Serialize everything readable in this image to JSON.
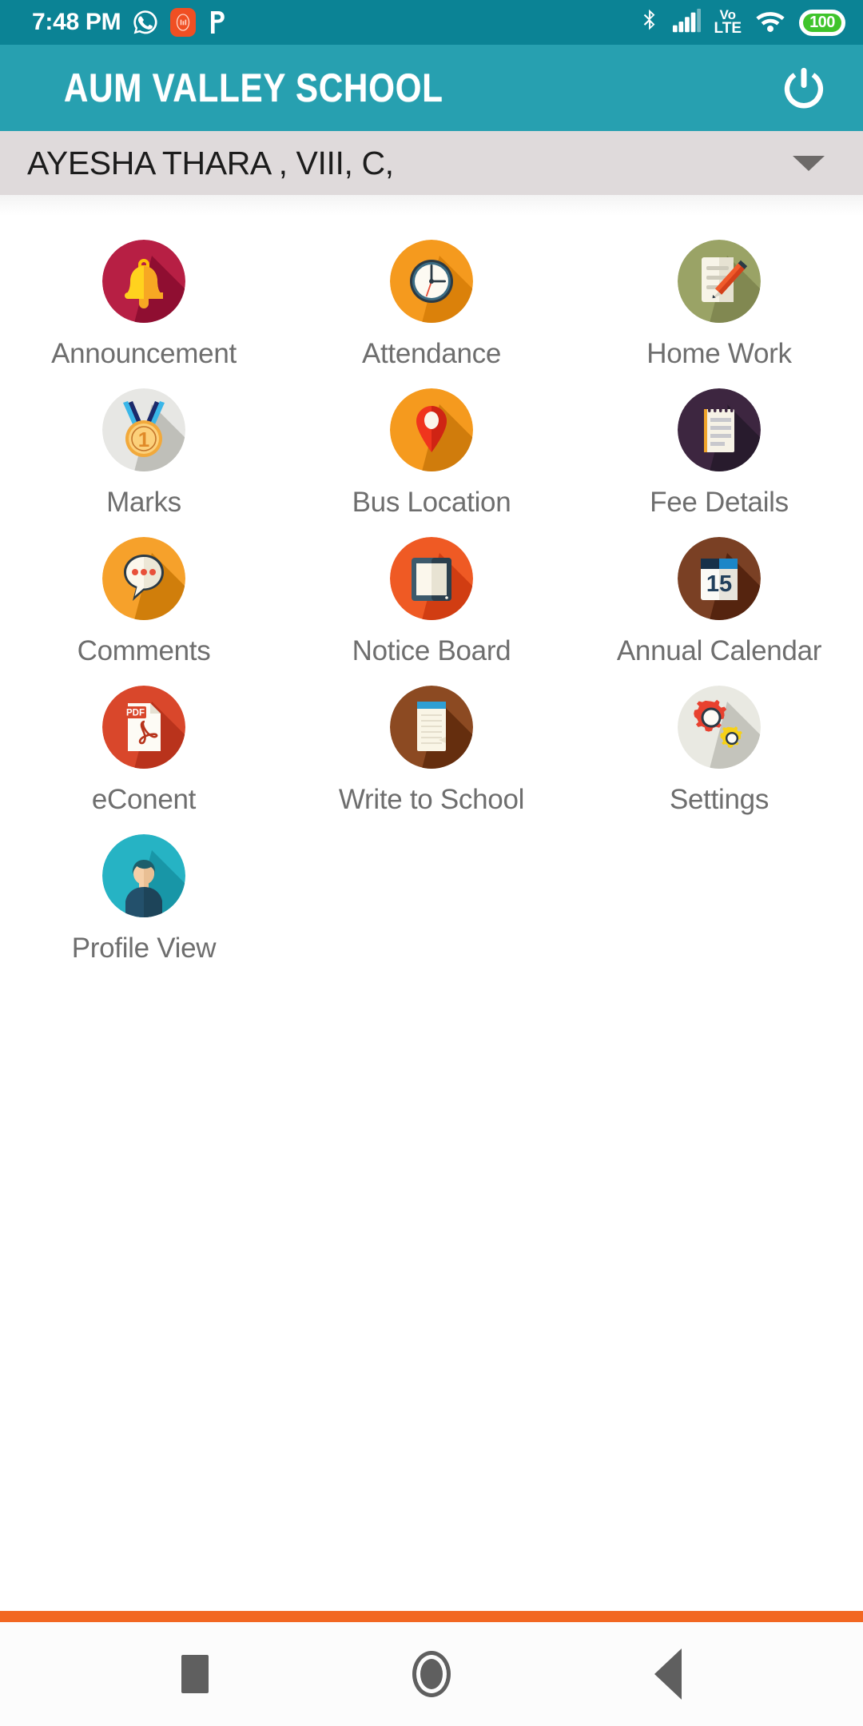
{
  "status_bar": {
    "time": "7:48 PM",
    "battery_level": "100",
    "network_type": "VoLTE",
    "volte_top": "Vo",
    "volte_bottom": "LTE",
    "icons": [
      "whatsapp-icon",
      "mi-video-call-icon",
      "phonepe-icon",
      "bluetooth-icon",
      "cellular-signal-icon",
      "volte-icon",
      "wifi-icon",
      "battery-icon"
    ],
    "background_color": "#0b8395"
  },
  "app_bar": {
    "title": "AUM VALLEY SCHOOL",
    "power_icon": "power-icon",
    "background_color": "#27a0b0",
    "title_color": "#ffffff"
  },
  "student_select": {
    "value": "AYESHA THARA , VIII, C,",
    "caret_icon": "chevron-down-icon",
    "background_color": "#dfdadb"
  },
  "grid": {
    "items": [
      {
        "label": "Announcement",
        "icon": "bell-icon",
        "bg": "#b71f44",
        "shadow": "#8c0e30"
      },
      {
        "label": "Attendance",
        "icon": "clock-icon",
        "bg": "#f59a1e",
        "shadow": "#d97f0a"
      },
      {
        "label": "Home Work",
        "icon": "notepad-pencil-icon",
        "bg": "#9aa366",
        "shadow": "#7f8750"
      },
      {
        "label": "Marks",
        "icon": "medal-icon",
        "bg": "#e7e7e4",
        "shadow": "#bdbdb6"
      },
      {
        "label": "Bus Location",
        "icon": "map-pin-icon",
        "bg": "#f59a1e",
        "shadow": "#cd7a0c"
      },
      {
        "label": "Fee Details",
        "icon": "notebook-icon",
        "bg": "#3d2640",
        "shadow": "#271a2c"
      },
      {
        "label": "Comments",
        "icon": "speech-bubble-icon",
        "bg": "#f6a12b",
        "shadow": "#cd7c0a"
      },
      {
        "label": "Notice Board",
        "icon": "tablet-icon",
        "bg": "#ef5a24",
        "shadow": "#cf3c12"
      },
      {
        "label": "Annual Calendar",
        "icon": "calendar-icon",
        "bg": "#7a4024",
        "shadow": "#53230f"
      },
      {
        "label": "eConent",
        "icon": "pdf-file-icon",
        "bg": "#d9472b",
        "shadow": "#b7331b"
      },
      {
        "label": "Write to School",
        "icon": "notebook-lined-icon",
        "bg": "#8c4a22",
        "shadow": "#632c0e"
      },
      {
        "label": "Settings",
        "icon": "gears-icon",
        "bg": "#e9e9e2",
        "shadow": "#c2c2b9"
      },
      {
        "label": "Profile View",
        "icon": "avatar-icon",
        "bg": "#26b3c4",
        "shadow": "#1795a5"
      }
    ],
    "calendar_day": "15",
    "medal_number": "1",
    "pdf_label": "PDF",
    "label_color": "#6e6e6e"
  },
  "bottom": {
    "divider_color": "#f26722",
    "nav_buttons": [
      {
        "name": "recents-button",
        "icon": "square-icon"
      },
      {
        "name": "home-button",
        "icon": "circle-icon"
      },
      {
        "name": "back-button",
        "icon": "triangle-left-icon"
      }
    ]
  }
}
